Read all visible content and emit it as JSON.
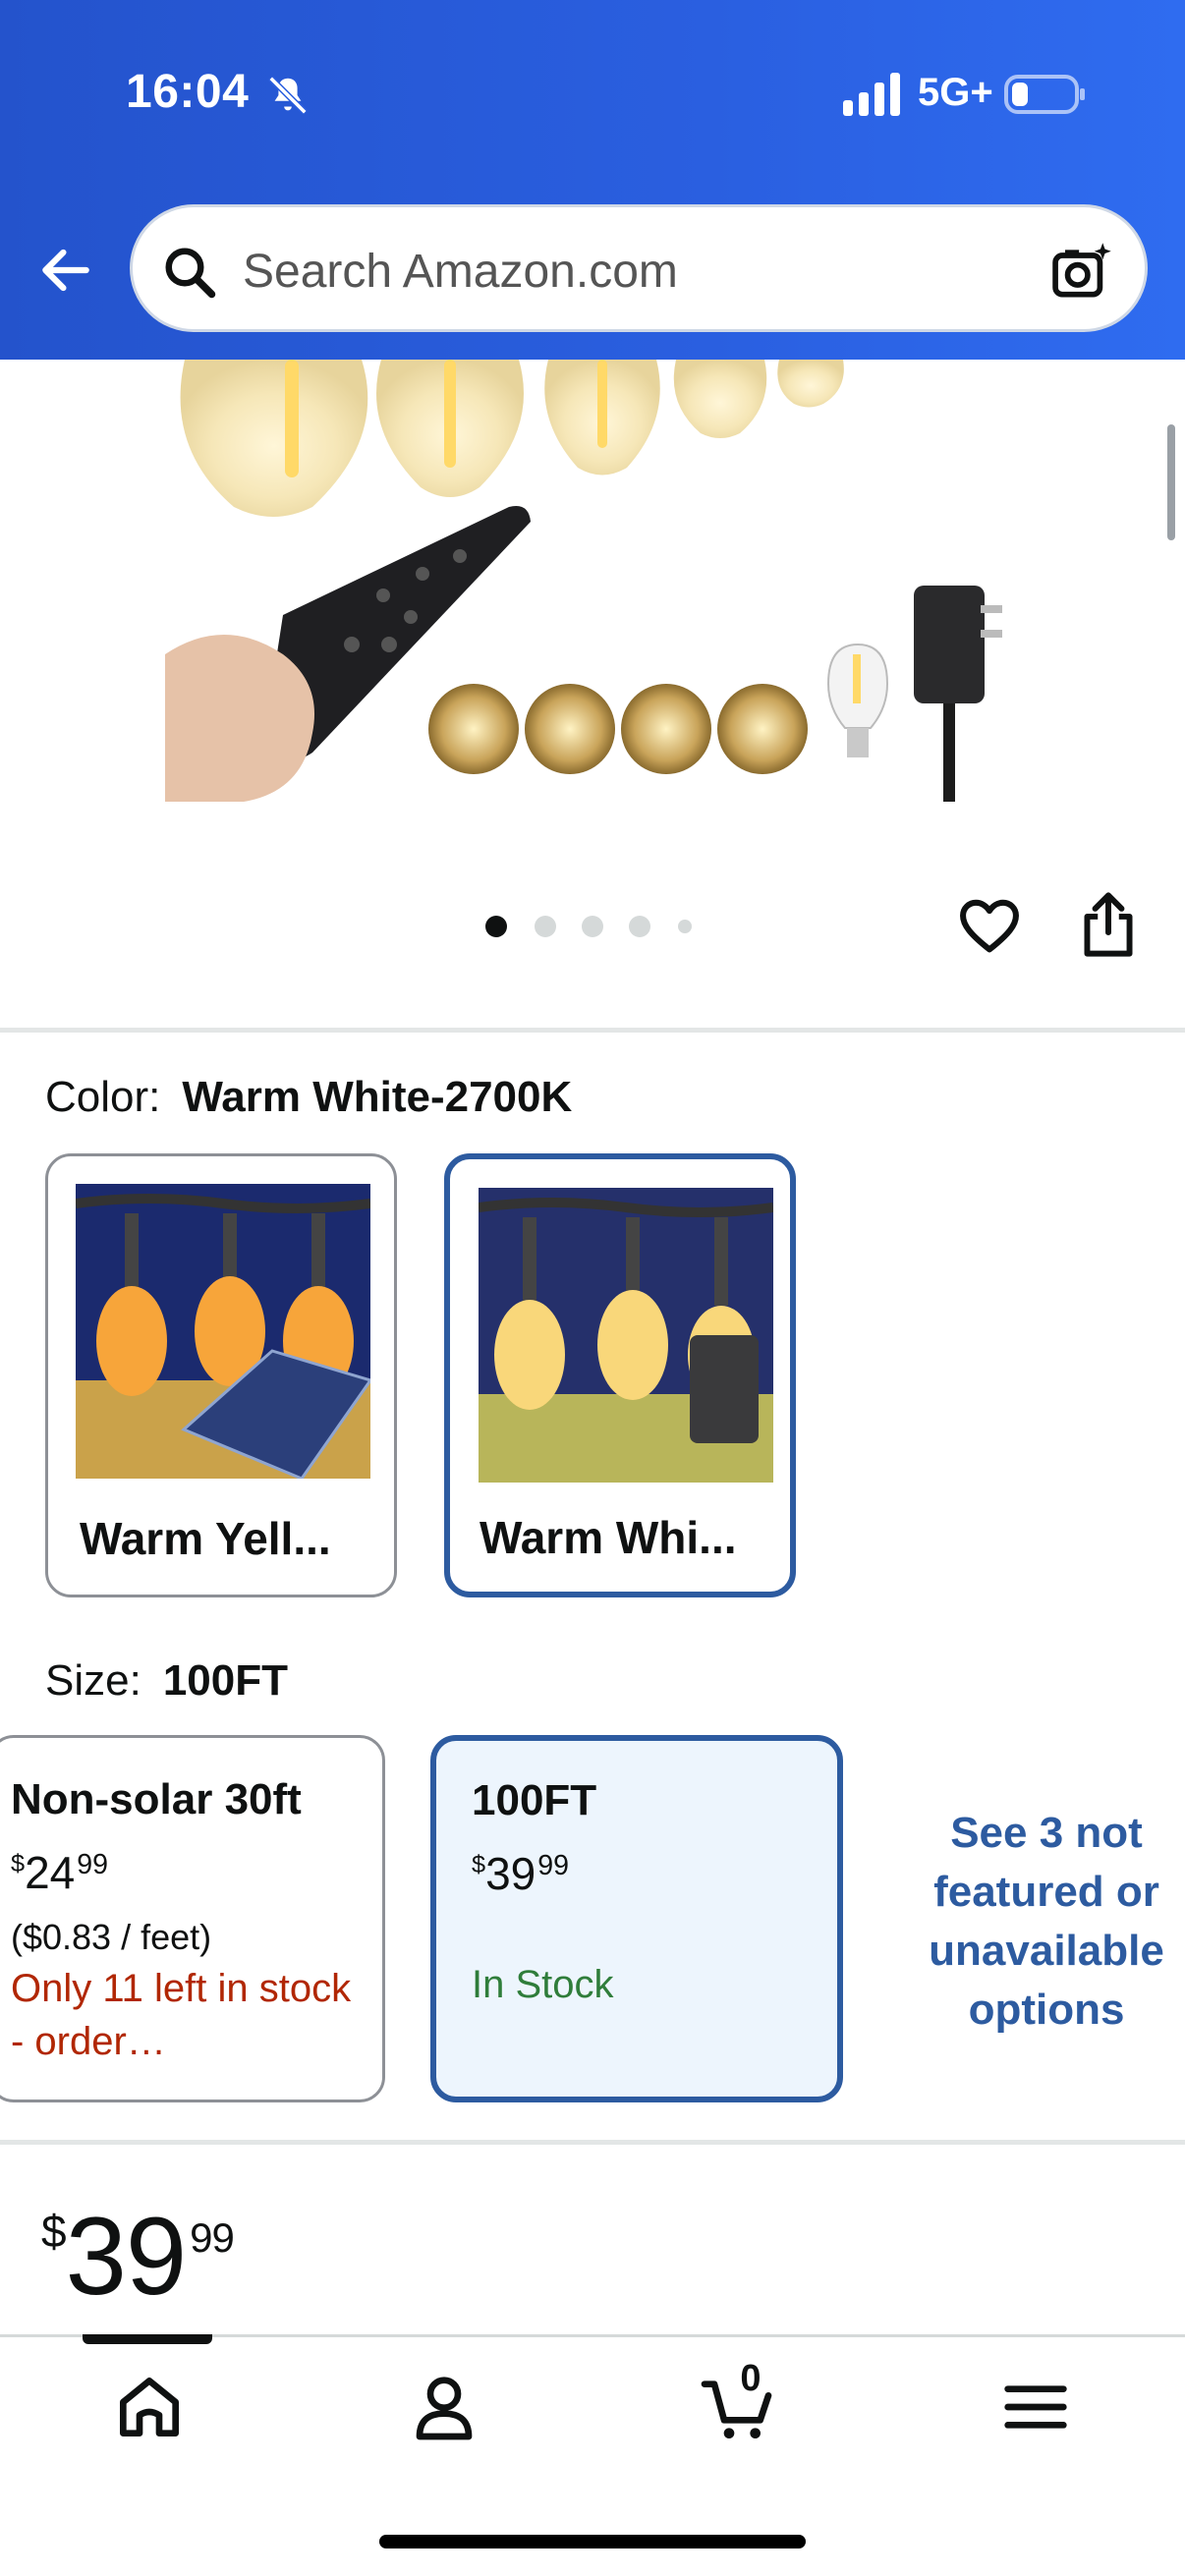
{
  "status_bar": {
    "time": "16:04",
    "network": "5G+"
  },
  "header": {
    "search_placeholder": "Search Amazon.com"
  },
  "gallery": {
    "dot_count": 5,
    "active_dot": 0
  },
  "color": {
    "label": "Color:",
    "selected": "Warm White-2700K",
    "options": [
      {
        "name": "Warm Yell...",
        "selected": false
      },
      {
        "name": "Warm Whi...",
        "selected": true
      }
    ]
  },
  "size": {
    "label": "Size:",
    "selected": "100FT",
    "options": [
      {
        "title": "Non-solar 30ft",
        "price_symbol": "$",
        "price_whole": "24",
        "price_cents": "99",
        "unit_price": "($0.83 / feet)",
        "stock": "Only 11 left in stock - order…"
      },
      {
        "title": "100FT",
        "price_symbol": "$",
        "price_whole": "39",
        "price_cents": "99",
        "stock": "In Stock"
      }
    ],
    "see_more": "See 3 not featured or unavailable options"
  },
  "price": {
    "symbol": "$",
    "whole": "39",
    "cents": "99"
  },
  "bottom_nav": {
    "cart_count": "0",
    "items": [
      "home-icon",
      "account-icon",
      "cart-icon",
      "menu-icon"
    ]
  },
  "colors": {
    "header_blue": "#2a5fe0",
    "selected_border": "#2d5ba0",
    "stock_red": "#b12704",
    "in_stock_green": "#2f7d3a"
  }
}
